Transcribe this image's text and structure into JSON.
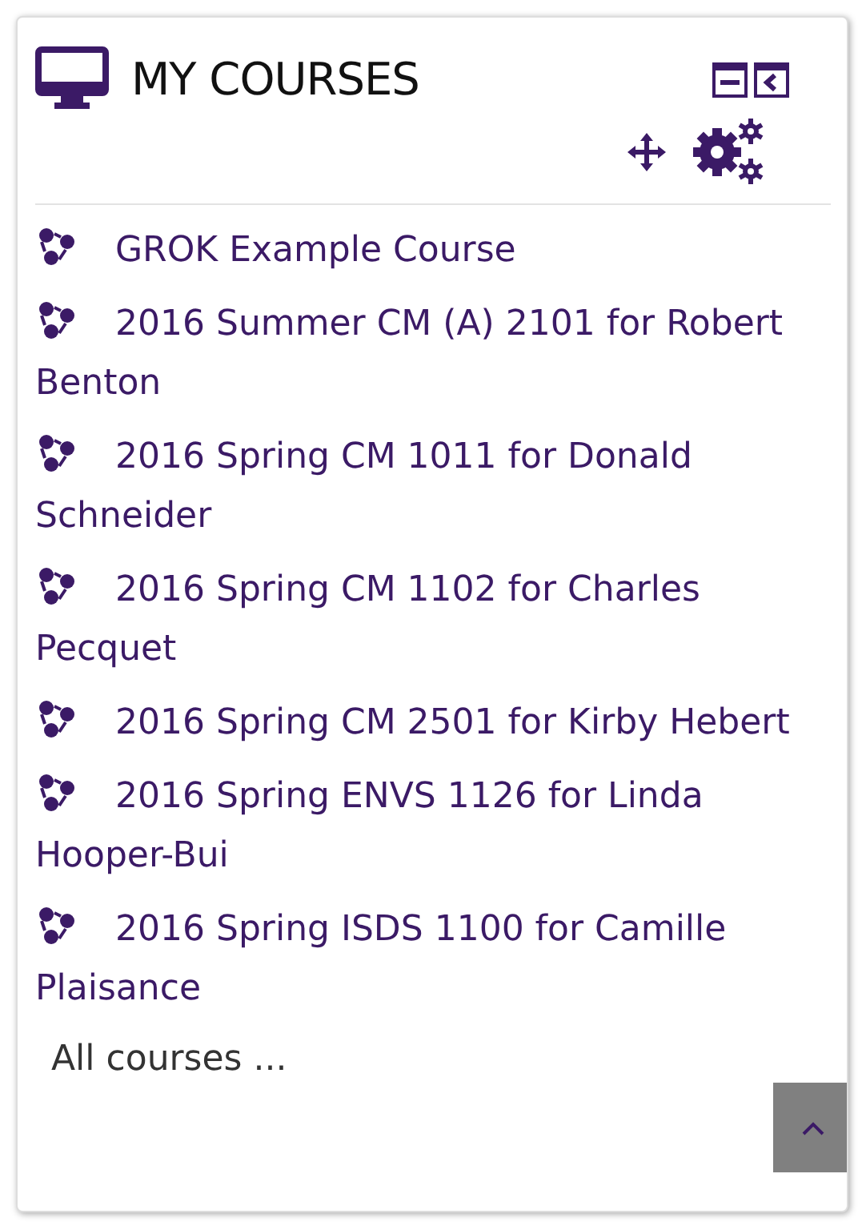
{
  "block": {
    "title": "MY COURSES",
    "courses": [
      {
        "name": "GROK Example Course"
      },
      {
        "name": "2016 Summer CM (A) 2101 for Robert Benton"
      },
      {
        "name": "2016 Spring CM 1011 for Donald Schneider"
      },
      {
        "name": "2016 Spring CM 1102 for Charles Pecquet"
      },
      {
        "name": "2016 Spring CM 2501 for Kirby Hebert"
      },
      {
        "name": "2016 Spring ENVS 1126 for Linda Hooper-Bui"
      },
      {
        "name": "2016 Spring ISDS 1100 for Camille Plaisance"
      }
    ],
    "footer_link": "All courses ..."
  }
}
